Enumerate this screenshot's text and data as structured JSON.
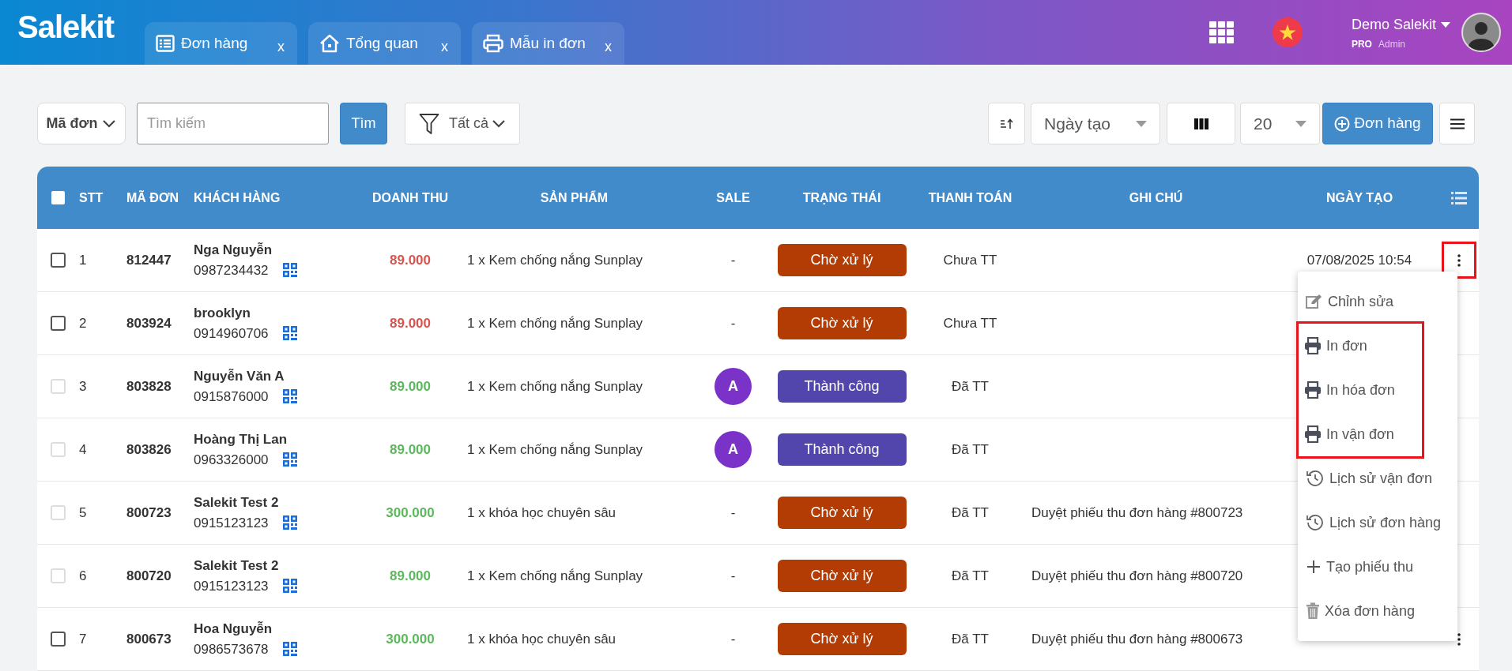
{
  "header": {
    "logo": "Salekit",
    "tabs": [
      {
        "kind": "list",
        "label": "Đơn hàng",
        "close": "x"
      },
      {
        "kind": "home",
        "label": "Tổng quan",
        "close": "x"
      },
      {
        "kind": "print",
        "label": "Mẫu in đơn",
        "close": "x"
      }
    ],
    "user": {
      "name": "Demo Salekit",
      "plan": "PRO",
      "role": "Admin"
    }
  },
  "toolbar": {
    "search_by": "Mã đơn",
    "search": {
      "placeholder": "Tìm kiếm"
    },
    "search_button": "Tìm",
    "filter": "Tất cả",
    "sort_by": "Ngày tạo",
    "page_size": "20",
    "add_button": "Đơn hàng"
  },
  "table": {
    "select_all": {
      "checked": false
    },
    "columns": [
      "STT",
      "MÃ ĐƠN",
      "KHÁCH HÀNG",
      "DOANH THU",
      "SẢN PHẨM",
      "SALE",
      "TRẠNG THÁI",
      "THANH TOÁN",
      "GHI CHÚ",
      "NGÀY TẠO"
    ],
    "rows": [
      {
        "checkbox_disabled": false,
        "stt": "1",
        "code": "812447",
        "customer": "Nga Nguyễn",
        "phone": "0987234432",
        "revenue": {
          "text": "89.000",
          "color": "#d9534f"
        },
        "product": "1 x Kem chống nắng Sunplay",
        "sale": {
          "kind": "none",
          "text": "-"
        },
        "status": {
          "kind": "pending",
          "label": "Chờ xử lý"
        },
        "payment": "Chưa TT",
        "date": "07/08/2025 10:54",
        "actions": {
          "highlighted": true
        }
      },
      {
        "checkbox_disabled": false,
        "stt": "2",
        "code": "803924",
        "customer": "brooklyn",
        "phone": "0914960706",
        "revenue": {
          "text": "89.000",
          "color": "#d9534f"
        },
        "product": "1 x Kem chống nắng Sunplay",
        "sale": {
          "kind": "none",
          "text": "-"
        },
        "status": {
          "kind": "pending",
          "label": "Chờ xử lý"
        },
        "payment": "Chưa TT"
      },
      {
        "checkbox_disabled": true,
        "stt": "3",
        "code": "803828",
        "customer": "Nguyễn Văn A",
        "phone": "0915876000",
        "revenue": {
          "text": "89.000",
          "color": "#5cb85c"
        },
        "product": "1 x Kem chống nắng Sunplay",
        "sale": {
          "kind": "avatar",
          "text": "A"
        },
        "status": {
          "kind": "success",
          "label": "Thành công"
        },
        "payment": "Đã TT"
      },
      {
        "checkbox_disabled": true,
        "stt": "4",
        "code": "803826",
        "customer": "Hoàng Thị Lan",
        "phone": "0963326000",
        "revenue": {
          "text": "89.000",
          "color": "#5cb85c"
        },
        "product": "1 x Kem chống nắng Sunplay",
        "sale": {
          "kind": "avatar",
          "text": "A"
        },
        "status": {
          "kind": "success",
          "label": "Thành công"
        },
        "payment": "Đã TT"
      },
      {
        "checkbox_disabled": true,
        "stt": "5",
        "code": "800723",
        "customer": "Salekit Test 2",
        "phone": "0915123123",
        "revenue": {
          "text": "300.000",
          "color": "#5cb85c"
        },
        "product": "1 x khóa học chuyên sâu",
        "sale": {
          "kind": "none",
          "text": "-"
        },
        "status": {
          "kind": "pending",
          "label": "Chờ xử lý"
        },
        "payment": "Đã TT",
        "note": "Duyệt phiếu thu đơn hàng #800723"
      },
      {
        "checkbox_disabled": true,
        "stt": "6",
        "code": "800720",
        "customer": "Salekit Test 2",
        "phone": "0915123123",
        "revenue": {
          "text": "89.000",
          "color": "#5cb85c"
        },
        "product": "1 x Kem chống nắng Sunplay",
        "sale": {
          "kind": "none",
          "text": "-"
        },
        "status": {
          "kind": "pending",
          "label": "Chờ xử lý"
        },
        "payment": "Đã TT",
        "note": "Duyệt phiếu thu đơn hàng #800720"
      },
      {
        "checkbox_disabled": false,
        "stt": "7",
        "code": "800673",
        "customer": "Hoa Nguyễn",
        "phone": "0986573678",
        "revenue": {
          "text": "300.000",
          "color": "#5cb85c"
        },
        "product": "1 x khóa học chuyên sâu",
        "sale": {
          "kind": "none",
          "text": "-"
        },
        "status": {
          "kind": "pending",
          "label": "Chờ xử lý"
        },
        "payment": "Đã TT",
        "note": "Duyệt phiếu thu đơn hàng #800673",
        "actions": {
          "highlighted": false
        }
      }
    ]
  },
  "action_menu": {
    "items": [
      {
        "kind": "edit",
        "label": "Chỉnh sửa",
        "highlighted": false
      },
      {
        "kind": "print",
        "label": "In đơn",
        "highlighted": true
      },
      {
        "kind": "print",
        "label": "In hóa đơn",
        "highlighted": true
      },
      {
        "kind": "print",
        "label": "In vận đơn",
        "highlighted": true
      },
      {
        "kind": "history",
        "label": "Lịch sử vận đơn",
        "highlighted": false
      },
      {
        "kind": "history",
        "label": "Lịch sử đơn hàng",
        "highlighted": false
      },
      {
        "kind": "plus",
        "label": "Tạo phiếu thu",
        "highlighted": false
      },
      {
        "kind": "trash",
        "label": "Xóa đơn hàng",
        "highlighted": false
      }
    ]
  }
}
